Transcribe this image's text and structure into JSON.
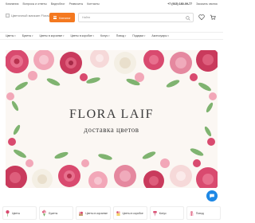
{
  "topbar": {
    "nav": [
      "Компания",
      "Вопросы и ответы",
      "Видеоблог",
      "Реквизиты",
      "Контакты"
    ],
    "phone": "+7 (915) 180-09-77",
    "callback": "Заказать звонок"
  },
  "header": {
    "logo_alt": "Цветочный магазин FloraLif",
    "catalog_label": "Каталог",
    "search_placeholder": "Найти"
  },
  "category_nav": [
    "Цветы",
    "Букеты",
    "Цветы в корзинке",
    "Цветы в коробке",
    "Конус",
    "Повод",
    "Подарки",
    "Аксессуары"
  ],
  "banner": {
    "title": "FLORA LAIF",
    "subtitle": "доставка цветов"
  },
  "categories": [
    {
      "label": "Цветы",
      "icon": "flower-icon"
    },
    {
      "label": "Букеты",
      "icon": "bouquet-icon"
    },
    {
      "label": "Цветы в корзинке",
      "icon": "basket-icon"
    },
    {
      "label": "Цветы в коробке",
      "icon": "box-icon"
    },
    {
      "label": "Конус",
      "icon": "cone-icon"
    },
    {
      "label": "Повод",
      "icon": "occasion-icon"
    }
  ],
  "colors": {
    "accent": "#f47920",
    "chat": "#1e88e5",
    "rose": "#d94a6f",
    "pink": "#f2a7b8",
    "leaf": "#6aa85a"
  }
}
